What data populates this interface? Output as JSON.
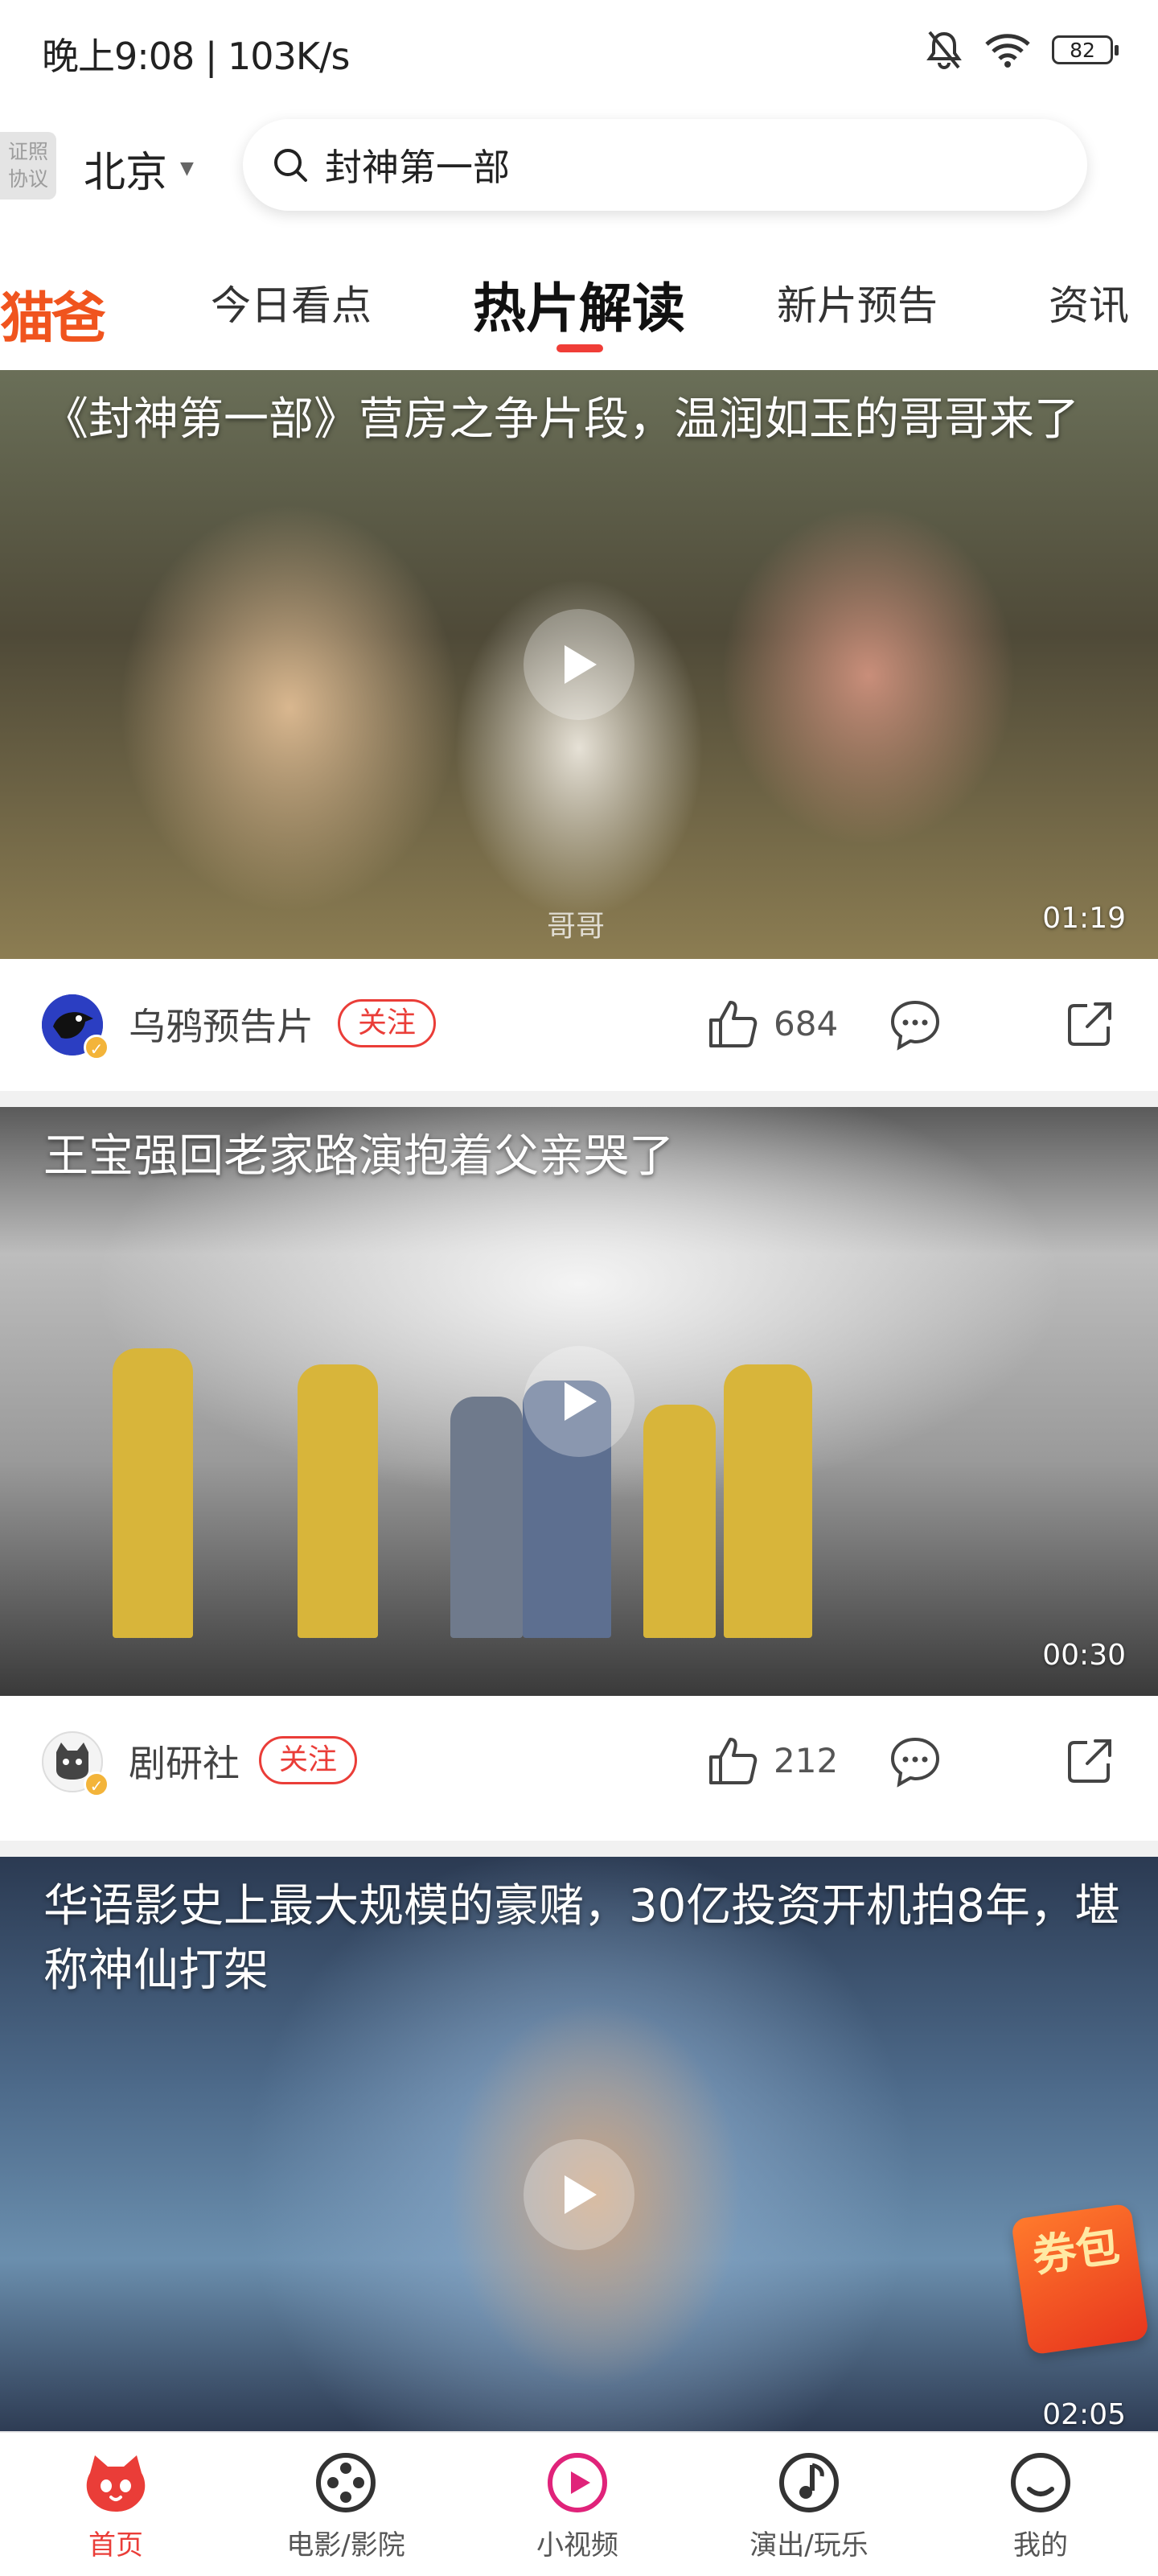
{
  "status_bar": {
    "time_speed": "晚上9:08 | 103K/s",
    "battery": "82"
  },
  "header": {
    "license_label": "证照\n协议",
    "license_line1": "证照",
    "license_line2": "协议",
    "city": "北京",
    "search_text": "封神第一部"
  },
  "tabs": [
    {
      "label": "今日看点",
      "active": false
    },
    {
      "label": "热片解读",
      "active": true
    },
    {
      "label": "新片预告",
      "active": false
    },
    {
      "label": "资讯",
      "active": false
    }
  ],
  "tab_logo_text": "猫爸",
  "feed": [
    {
      "title": "《封神第一部》营房之争片段，温润如玉的哥哥来了",
      "subtitle": "哥哥",
      "duration": "01:19",
      "author": "乌鸦预告片",
      "follow_label": "关注",
      "likes": "684"
    },
    {
      "title": "王宝强回老家路演抱着父亲哭了",
      "subtitle": "",
      "duration": "00:30",
      "author": "剧研社",
      "follow_label": "关注",
      "likes": "212"
    },
    {
      "title": "华语影史上最大规模的豪赌，30亿投资开机拍8年，堪称神仙打架",
      "subtitle": "",
      "duration": "02:05"
    }
  ],
  "coupon_label": "券包",
  "bottom_nav": [
    {
      "label": "首页",
      "icon": "cat-home-icon",
      "active": true
    },
    {
      "label": "电影/影院",
      "icon": "film-reel-icon",
      "active": false
    },
    {
      "label": "小视频",
      "icon": "play-circle-icon",
      "active": false
    },
    {
      "label": "演出/玩乐",
      "icon": "music-note-icon",
      "active": false
    },
    {
      "label": "我的",
      "icon": "profile-icon",
      "active": false
    }
  ],
  "colors": {
    "accent": "#ea3d38",
    "verified": "#f3b43a",
    "logo": "#f0541e"
  }
}
